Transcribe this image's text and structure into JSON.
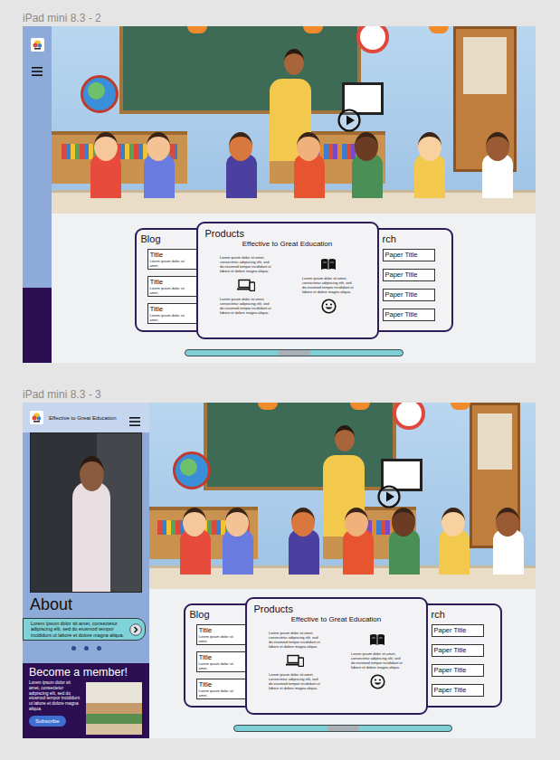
{
  "frames": [
    {
      "label": "iPad mini 8.3 - 2"
    },
    {
      "label": "iPad mini 8.3 - 3"
    }
  ],
  "side_panel": {
    "tagline": "Effective to Great Education",
    "about_title": "About",
    "about_text": "Lorem ipsum dolor sit amet, consectetur adipiscing elit, sed do eiusmod tempor incididunt ut labore et dolore magna aliqua.",
    "member_title": "Become a member!",
    "member_text": "Lorem ipsum dolor sit amet, consectetur adipiscing elit, sed do eiusmod tempor incididunt ut labore et dolore magna aliqua.",
    "subscribe": "Subscribe"
  },
  "cards": {
    "blog": {
      "title": "Blog",
      "items": [
        {
          "title": "Title",
          "text": "Lorem ipsum dolor sit amet,"
        },
        {
          "title": "Title",
          "text": "Lorem ipsum dolor sit amet,"
        },
        {
          "title": "Title",
          "text": "Lorem ipsum dolor sit amet,"
        }
      ]
    },
    "products": {
      "title": "Products",
      "subtitle": "Effective to Great Education",
      "features": [
        "Lorem ipsum dolor sit amet, consectetur adipiscing elit, sed do eiusmod tempor incididunt ut labore et dolore magna aliqua.",
        "Lorem ipsum dolor sit amet, consectetur adipiscing elit, sed do eiusmod tempor incididunt ut labore et dolore magna aliqua.",
        "Lorem ipsum dolor sit amet, consectetur adipiscing elit, sed do eiusmod tempor incididunt ut labore et dolore magna aliqua."
      ]
    },
    "research": {
      "title": "rch",
      "items": [
        "Paper Title",
        "Paper Title",
        "Paper Title",
        "Paper Title"
      ]
    }
  }
}
